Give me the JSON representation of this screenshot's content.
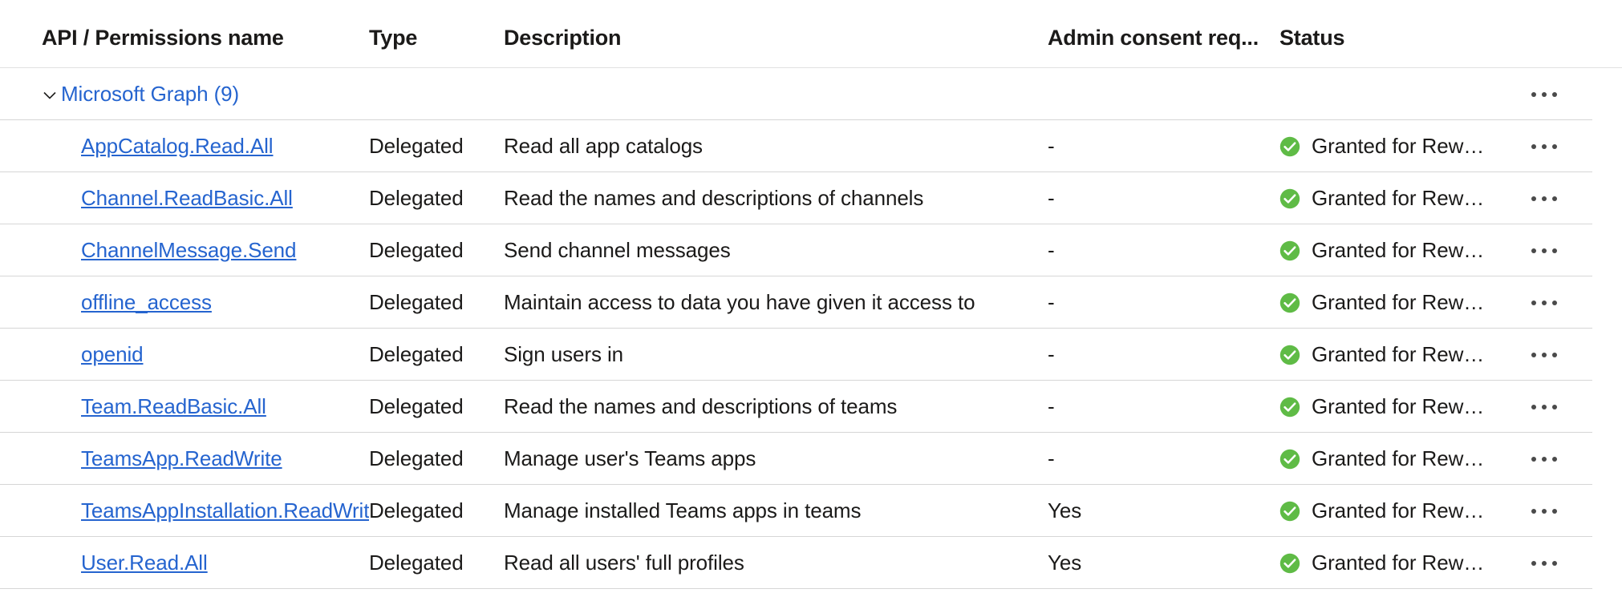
{
  "table": {
    "columns": [
      {
        "key": "name",
        "label": "API / Permissions name"
      },
      {
        "key": "type",
        "label": "Type"
      },
      {
        "key": "desc",
        "label": "Description"
      },
      {
        "key": "consent",
        "label": "Admin consent req..."
      },
      {
        "key": "status",
        "label": "Status"
      }
    ],
    "group": {
      "label": "Microsoft Graph (9)",
      "count": 9,
      "expanded": true,
      "chevron_icon": "chevron-down-icon",
      "actions_icon": "more-actions-ellipsis-icon"
    },
    "rows": [
      {
        "name": "AppCatalog.Read.All",
        "type": "Delegated",
        "desc": "Read all app catalogs",
        "consent": "-",
        "status": "Granted for Reward Gat…",
        "status_icon": "granted-check-circle-icon",
        "actions_icon": "more-actions-ellipsis-icon"
      },
      {
        "name": "Channel.ReadBasic.All",
        "type": "Delegated",
        "desc": "Read the names and descriptions of channels",
        "consent": "-",
        "status": "Granted for Reward Gat…",
        "status_icon": "granted-check-circle-icon",
        "actions_icon": "more-actions-ellipsis-icon"
      },
      {
        "name": "ChannelMessage.Send",
        "type": "Delegated",
        "desc": "Send channel messages",
        "consent": "-",
        "status": "Granted for Reward Gat…",
        "status_icon": "granted-check-circle-icon",
        "actions_icon": "more-actions-ellipsis-icon"
      },
      {
        "name": "offline_access",
        "type": "Delegated",
        "desc": "Maintain access to data you have given it access to",
        "consent": "-",
        "status": "Granted for Reward Gat…",
        "status_icon": "granted-check-circle-icon",
        "actions_icon": "more-actions-ellipsis-icon"
      },
      {
        "name": "openid",
        "type": "Delegated",
        "desc": "Sign users in",
        "consent": "-",
        "status": "Granted for Reward Gat…",
        "status_icon": "granted-check-circle-icon",
        "actions_icon": "more-actions-ellipsis-icon"
      },
      {
        "name": "Team.ReadBasic.All",
        "type": "Delegated",
        "desc": "Read the names and descriptions of teams",
        "consent": "-",
        "status": "Granted for Reward Gat…",
        "status_icon": "granted-check-circle-icon",
        "actions_icon": "more-actions-ellipsis-icon"
      },
      {
        "name": "TeamsApp.ReadWrite",
        "type": "Delegated",
        "desc": "Manage user's Teams apps",
        "consent": "-",
        "status": "Granted for Reward Gat…",
        "status_icon": "granted-check-circle-icon",
        "actions_icon": "more-actions-ellipsis-icon"
      },
      {
        "name": "TeamsAppInstallation.ReadWrite.ForTeam",
        "type": "Delegated",
        "desc": "Manage installed Teams apps in teams",
        "consent": "Yes",
        "status": "Granted for Reward Gat…",
        "status_icon": "granted-check-circle-icon",
        "actions_icon": "more-actions-ellipsis-icon"
      },
      {
        "name": "User.Read.All",
        "type": "Delegated",
        "desc": "Read all users' full profiles",
        "consent": "Yes",
        "status": "Granted for Reward Gat…",
        "status_icon": "granted-check-circle-icon",
        "actions_icon": "more-actions-ellipsis-icon"
      }
    ]
  },
  "colors": {
    "link": "#2564cf",
    "text": "#1b1a19",
    "granted_green": "#5fbb46",
    "separator": "#d6d6d6",
    "background": "#ffffff"
  }
}
